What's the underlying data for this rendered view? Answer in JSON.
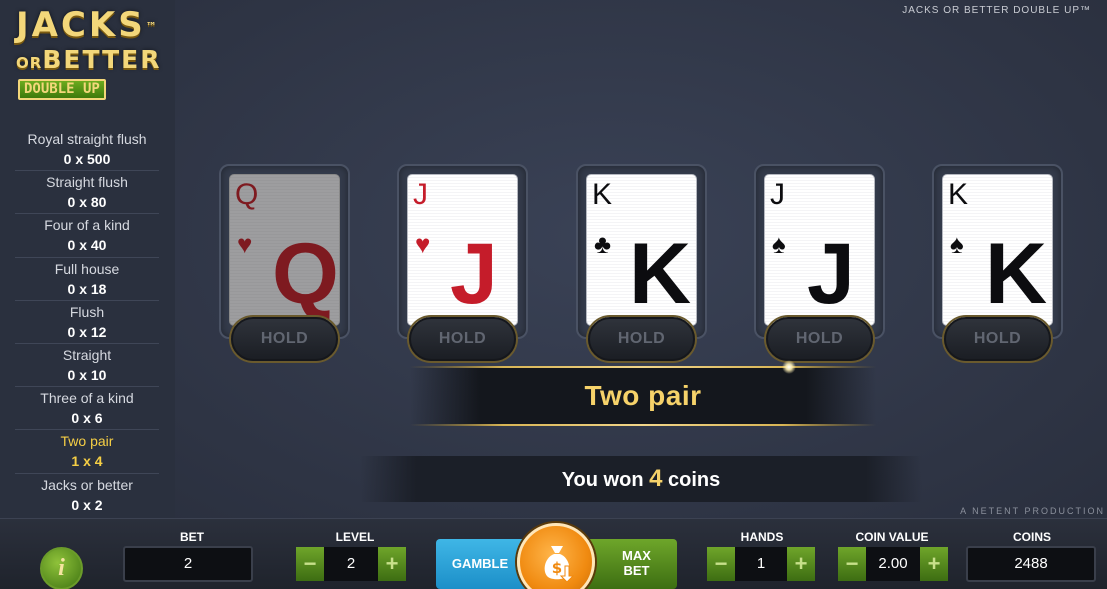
{
  "game_title": "JACKS OR BETTER DOUBLE UP™",
  "producer": "A NETENT PRODUCTION",
  "logo": {
    "line1": "JACKS",
    "tm": "™",
    "line2_or": "OR",
    "line2_better": "BETTER",
    "badge": "DOUBLE UP"
  },
  "paytable": [
    {
      "name": "Royal straight flush",
      "value": "0 x 500",
      "active": false
    },
    {
      "name": "Straight flush",
      "value": "0 x 80",
      "active": false
    },
    {
      "name": "Four of a kind",
      "value": "0 x 40",
      "active": false
    },
    {
      "name": "Full house",
      "value": "0 x 18",
      "active": false
    },
    {
      "name": "Flush",
      "value": "0 x 12",
      "active": false
    },
    {
      "name": "Straight",
      "value": "0 x 10",
      "active": false
    },
    {
      "name": "Three of a kind",
      "value": "0 x 6",
      "active": false
    },
    {
      "name": "Two pair",
      "value": "1 x 4",
      "active": true
    },
    {
      "name": "Jacks or better",
      "value": "0 x 2",
      "active": false
    }
  ],
  "cards": [
    {
      "rank": "Q",
      "suit": "♥",
      "suit_name": "heart",
      "color": "red",
      "dimmed": true,
      "hold_label": "HOLD"
    },
    {
      "rank": "J",
      "suit": "♥",
      "suit_name": "heart",
      "color": "red",
      "dimmed": false,
      "hold_label": "HOLD"
    },
    {
      "rank": "K",
      "suit": "♣",
      "suit_name": "club",
      "color": "black",
      "dimmed": false,
      "hold_label": "HOLD"
    },
    {
      "rank": "J",
      "suit": "♠",
      "suit_name": "spade",
      "color": "black",
      "dimmed": false,
      "hold_label": "HOLD"
    },
    {
      "rank": "K",
      "suit": "♠",
      "suit_name": "spade",
      "color": "black",
      "dimmed": false,
      "hold_label": "HOLD"
    }
  ],
  "result": {
    "hand": "Two pair",
    "win_prefix": "You won",
    "win_amount": "4",
    "win_suffix": "coins"
  },
  "controls": {
    "info_label": "i",
    "bet": {
      "label": "BET",
      "value": "2"
    },
    "level": {
      "label": "LEVEL",
      "value": "2",
      "minus": "−",
      "plus": "+"
    },
    "gamble_label": "GAMBLE",
    "maxbet_line1": "MAX",
    "maxbet_line2": "BET",
    "hands": {
      "label": "HANDS",
      "value": "1",
      "minus": "−",
      "plus": "+"
    },
    "coin_value": {
      "label": "COIN VALUE",
      "value": "2.00",
      "minus": "−",
      "plus": "+"
    },
    "coins": {
      "label": "COINS",
      "value": "2488"
    }
  },
  "colors": {
    "gold": "#f6d26a",
    "gamble_blue": "#1c8fc8",
    "green": "#3d6e12",
    "deal_orange": "#f08a10"
  }
}
